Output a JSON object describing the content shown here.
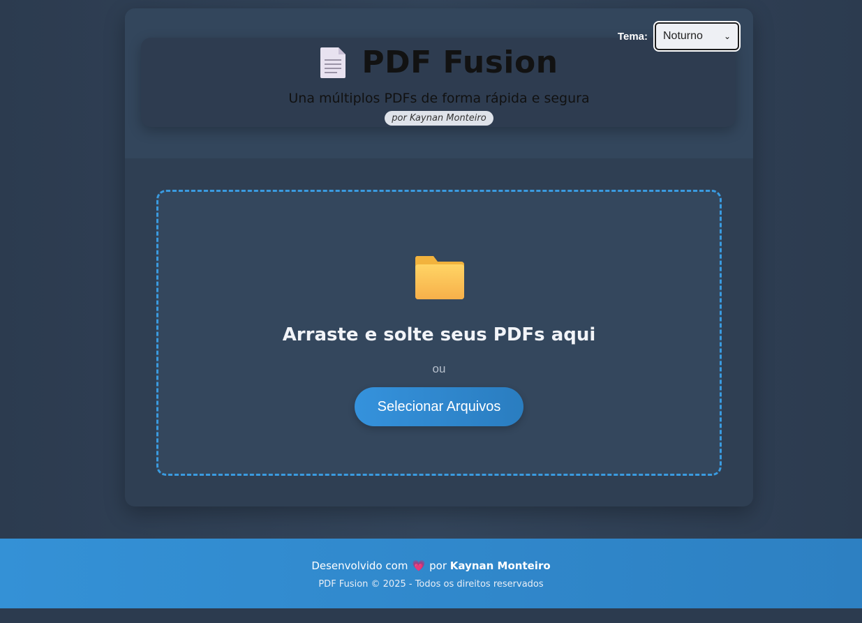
{
  "header": {
    "theme_label": "Tema:",
    "theme_value": "Noturno",
    "title": "PDF Fusion",
    "subtitle": "Una múltiplos PDFs de forma rápida e segura",
    "byline": "por Kaynan Monteiro",
    "icon": "document-icon"
  },
  "dropzone": {
    "icon": "folder-icon",
    "title": "Arraste e solte seus PDFs aqui",
    "or_text": "ou",
    "button_label": "Selecionar Arquivos"
  },
  "footer": {
    "line1_prefix": "Desenvolvido com",
    "heart": "💗",
    "line1_by": "por",
    "author": "Kaynan Monteiro",
    "line2": "PDF Fusion © 2025 - Todos os direitos reservados"
  },
  "colors": {
    "accent": "#3592dc",
    "dropzone_border": "#3a9be0",
    "background": "#2e3e52"
  }
}
